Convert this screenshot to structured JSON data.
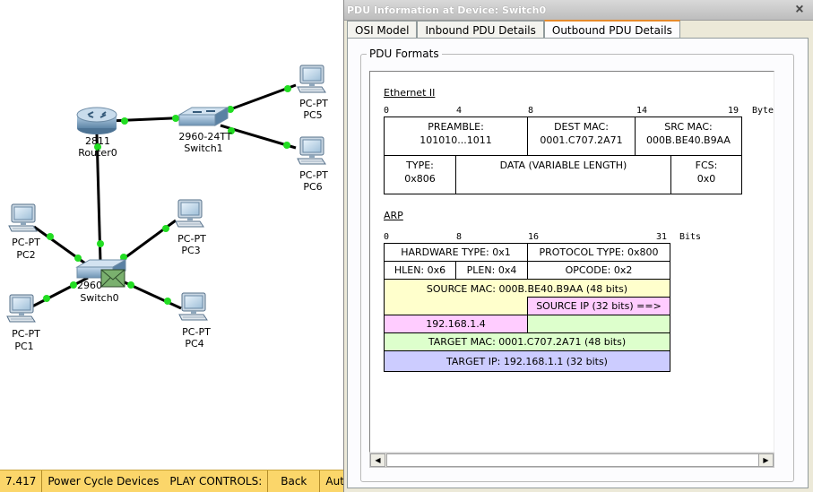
{
  "window": {
    "title": "PDU Information at Device: Switch0",
    "close": "×"
  },
  "tabs": [
    {
      "label": "OSI Model"
    },
    {
      "label": "Inbound PDU Details"
    },
    {
      "label": "Outbound PDU Details"
    }
  ],
  "formats_group": {
    "legend": "PDU Formats"
  },
  "ethernet": {
    "title": "Ethernet II",
    "ruler": [
      "0",
      "4",
      "8",
      "14",
      "19"
    ],
    "unit": "Bytes",
    "preamble": {
      "label": "PREAMBLE:",
      "value": "101010...1011"
    },
    "dest_mac": {
      "label": "DEST MAC:",
      "value": "0001.C707.2A71"
    },
    "src_mac": {
      "label": "SRC MAC:",
      "value": "000B.BE40.B9AA"
    },
    "type": {
      "label": "TYPE:",
      "value": "0x806"
    },
    "data": {
      "label": "DATA (VARIABLE LENGTH)"
    },
    "fcs": {
      "label": "FCS:",
      "value": "0x0"
    }
  },
  "arp": {
    "title": "ARP",
    "ruler": [
      "0",
      "8",
      "16",
      "31"
    ],
    "unit": "Bits",
    "hardware_type": "HARDWARE TYPE: 0x1",
    "protocol_type": "PROTOCOL TYPE: 0x800",
    "hlen": "HLEN: 0x6",
    "plen": "PLEN: 0x4",
    "opcode": "OPCODE: 0x2",
    "source_mac": "SOURCE MAC: 000B.BE40.B9AA (48 bits)",
    "source_ip_label": "SOURCE IP (32 bits) ==>",
    "source_ip_value": "192.168.1.4",
    "target_mac": "TARGET MAC: 0001.C707.2A71 (48 bits)",
    "target_ip": "TARGET IP: 192.168.1.1 (32 bits)",
    "colors": {
      "source_mac": "#ffffcc",
      "source_ip": "#ffccff",
      "target_mac": "#ddffcc",
      "target_ip": "#ccccff"
    }
  },
  "topology": {
    "devices": [
      {
        "id": "router0",
        "model": "2811",
        "name": "Router0"
      },
      {
        "id": "switch1",
        "model": "2960-24TT",
        "name": "Switch1"
      },
      {
        "id": "switch0",
        "model": "2960-",
        "name": "Switch0"
      },
      {
        "id": "pc1",
        "model": "PC-PT",
        "name": "PC1"
      },
      {
        "id": "pc2",
        "model": "PC-PT",
        "name": "PC2"
      },
      {
        "id": "pc3",
        "model": "PC-PT",
        "name": "PC3"
      },
      {
        "id": "pc4",
        "model": "PC-PT",
        "name": "PC4"
      },
      {
        "id": "pc5",
        "model": "PC-PT",
        "name": "PC5"
      },
      {
        "id": "pc6",
        "model": "PC-PT",
        "name": "PC6"
      }
    ],
    "link_color": "#000000",
    "port_color": "#22dd22"
  },
  "statusbar": {
    "time": "7.417",
    "power_cycle": "Power Cycle Devices",
    "play_controls": "PLAY CONTROLS:",
    "back": "Back",
    "auto": "Auto"
  }
}
